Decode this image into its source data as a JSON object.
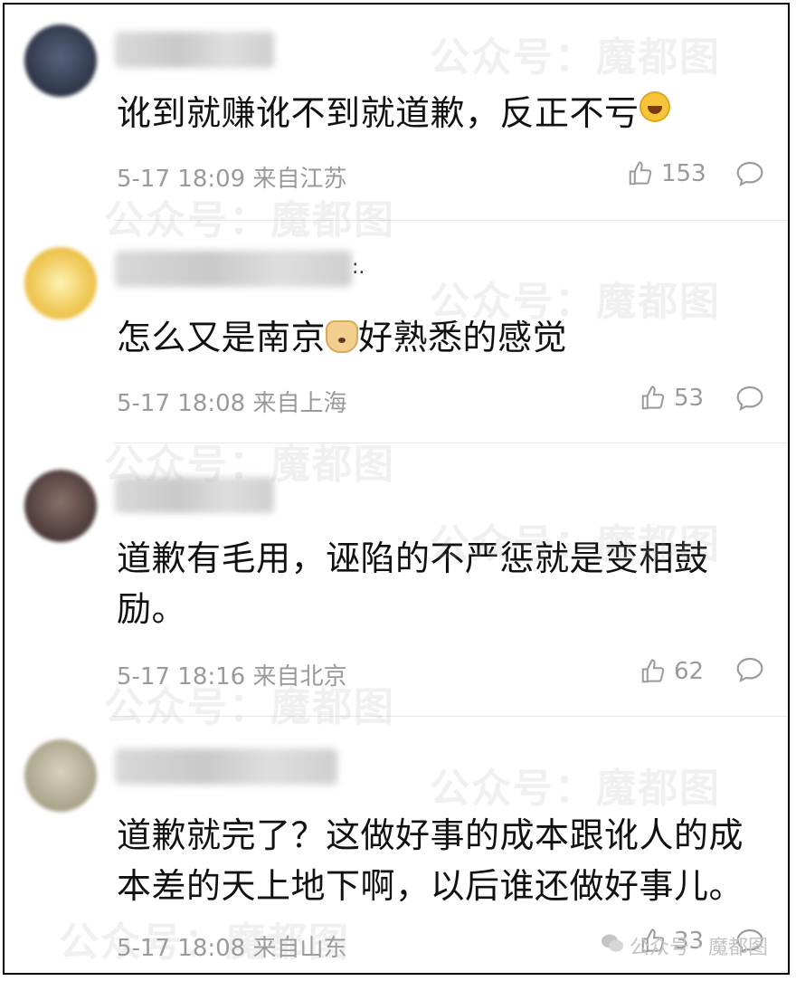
{
  "comments": [
    {
      "text": "讹到就赚讹不到就道歉，反正不亏",
      "emoji": "laughing-emoji",
      "time": "5-17 18:09",
      "location": "来自江苏",
      "likes": "153",
      "avatar_color": "#3a4660"
    },
    {
      "text_before": "怎么又是南京",
      "text_after": "好熟悉的感觉",
      "emoji": "dog-emoji",
      "username_suffix": ":.",
      "time": "5-17 18:08",
      "location": "来自上海",
      "likes": "53",
      "avatar_color": "#f2d067"
    },
    {
      "text": "道歉有毛用，诬陷的不严惩就是变相鼓励。",
      "time": "5-17 18:16",
      "location": "来自北京",
      "likes": "62",
      "avatar_color": "#5a4644"
    },
    {
      "text": "道歉就完了？这做好事的成本跟讹人的成本差的天上地下啊，以后谁还做好事儿。",
      "time": "5-17 18:08",
      "location": "来自山东",
      "likes": "33",
      "avatar_color": "#b7b19a"
    }
  ],
  "watermark": {
    "text": "公众号：魔都图"
  },
  "footer": {
    "brand": "公众号 · 魔都图"
  }
}
